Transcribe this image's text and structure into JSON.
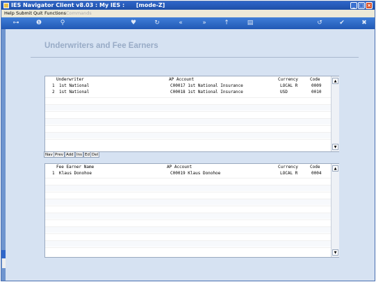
{
  "titlebar": {
    "title": "IES Navigator Client v8.03 : My IES :      [mode-Z]"
  },
  "menu": {
    "help": "Help",
    "submit": "Submit",
    "quit": "Quit",
    "functions": "Functions",
    "commands": "Commands"
  },
  "toolbar": {
    "icons": [
      "key-icon",
      "info-icon",
      "search-icon",
      "heart-icon",
      "refresh-icon",
      "rewind-icon",
      "fast-forward-icon",
      "up-icon",
      "stack-icon",
      "sync-icon",
      "check-icon",
      "close-icon"
    ]
  },
  "page": {
    "heading": "Underwriters and Fee Earners"
  },
  "underwriters": {
    "headers": {
      "underwriter": "Underwriter",
      "ap_account": "AP Account",
      "currency": "Currency",
      "code": "Code"
    },
    "rows": [
      {
        "num": "1",
        "underwriter": "1st National",
        "ap_account": "C00017 1st National Insurance",
        "currency": "LOCAL R",
        "code": "0009"
      },
      {
        "num": "2",
        "underwriter": "1st National",
        "ap_account": "C00018 1st National Insurance",
        "currency": "USD",
        "code": "0010"
      }
    ]
  },
  "navbar": {
    "nav": "Nav",
    "prev": "Prev",
    "add": "Add",
    "ins": "Ins",
    "ed": "Ed",
    "del": "Del"
  },
  "fee_earners": {
    "headers": {
      "fee_earner_name": "Fee Earner Name",
      "ap_account": "AP Account",
      "currency": "Currency",
      "code": "Code"
    },
    "rows": [
      {
        "num": "1",
        "name": "Klaus Donohoe",
        "ap_account": "C00019 Klaus Donohoe",
        "currency": "LOCAL R",
        "code": "0004"
      }
    ]
  },
  "colors": {
    "titlebar": "#2f66c9",
    "toolbar": "#2f6bc6",
    "content_bg": "#d6e2f2",
    "heading": "#98abc6"
  }
}
